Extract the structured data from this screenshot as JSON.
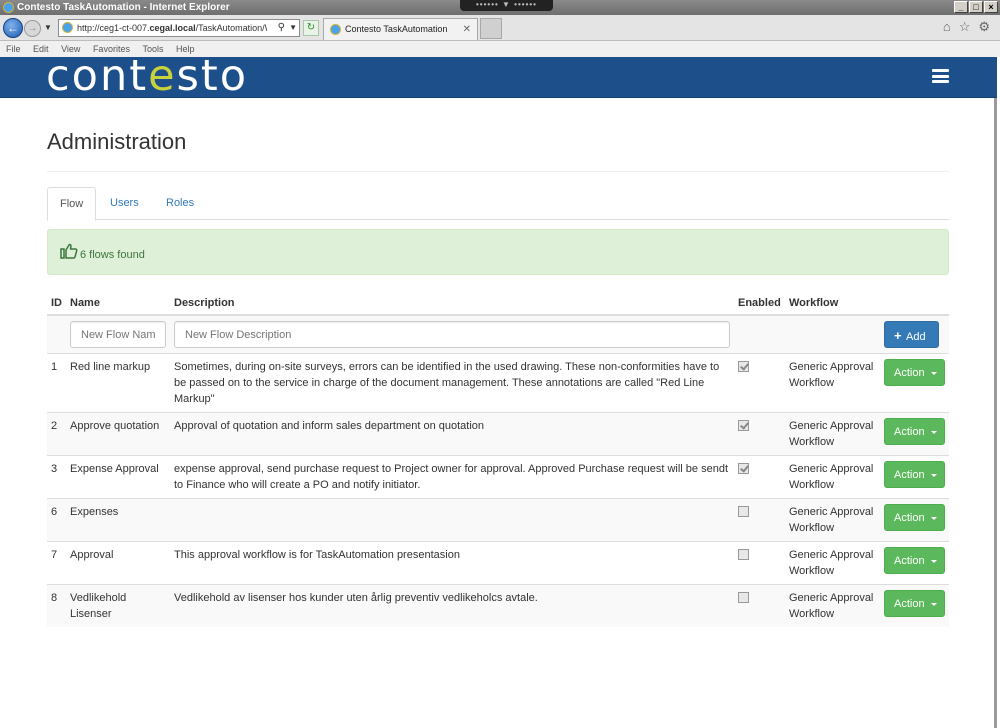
{
  "browser": {
    "window_title": "Contesto TaskAutomation - Internet Explorer",
    "url_prefix": "http://ceg1-ct-007.",
    "url_domain": "cegal.local",
    "url_rest": "/TaskAutomation/W",
    "tab_title": "Contesto TaskAutomation",
    "menu": [
      "File",
      "Edit",
      "View",
      "Favorites",
      "Tools",
      "Help"
    ]
  },
  "app": {
    "logo_pre": "cont",
    "logo_e": "e",
    "logo_post": "sto",
    "brand_color": "#1d4f8a",
    "logo_accent": "#c9d23b"
  },
  "page": {
    "title": "Administration",
    "tabs": [
      {
        "label": "Flow",
        "active": true
      },
      {
        "label": "Users",
        "active": false
      },
      {
        "label": "Roles",
        "active": false
      }
    ],
    "alert_text": "6 flows found"
  },
  "table": {
    "headers": {
      "id": "ID",
      "name": "Name",
      "description": "Description",
      "enabled": "Enabled",
      "workflow": "Workflow"
    },
    "new_name_placeholder": "New Flow Nam",
    "new_desc_placeholder": "New Flow Description",
    "add_label": "Add",
    "action_label": "Action",
    "rows": [
      {
        "id": "1",
        "name": "Red line markup",
        "description": "Sometimes, during on-site surveys, errors can be identified in the used drawing. These non-conformities have to be passed on to the service in charge of the document management. These annotations are called \"Red Line Markup\"",
        "enabled": true,
        "workflow": "Generic Approval Workflow"
      },
      {
        "id": "2",
        "name": "Approve quotation",
        "description": "Approval of quotation and inform sales department on quotation",
        "enabled": true,
        "workflow": "Generic Approval Workflow"
      },
      {
        "id": "3",
        "name": "Expense Approval",
        "description": "expense approval, send purchase request to Project owner for approval. Approved Purchase request will be sendt to Finance who will create a PO and notify initiator.",
        "enabled": true,
        "workflow": "Generic Approval Workflow"
      },
      {
        "id": "6",
        "name": "Expenses",
        "description": "",
        "enabled": false,
        "workflow": "Generic Approval Workflow"
      },
      {
        "id": "7",
        "name": "Approval",
        "description": "This approval workflow is for TaskAutomation presentasion",
        "enabled": false,
        "workflow": "Generic Approval Workflow"
      },
      {
        "id": "8",
        "name": "Vedlikehold Lisenser",
        "description": "Vedlikehold av lisenser hos kunder uten årlig preventiv vedlikeholcs avtale.",
        "enabled": false,
        "workflow": "Generic Approval Workflow"
      }
    ]
  }
}
